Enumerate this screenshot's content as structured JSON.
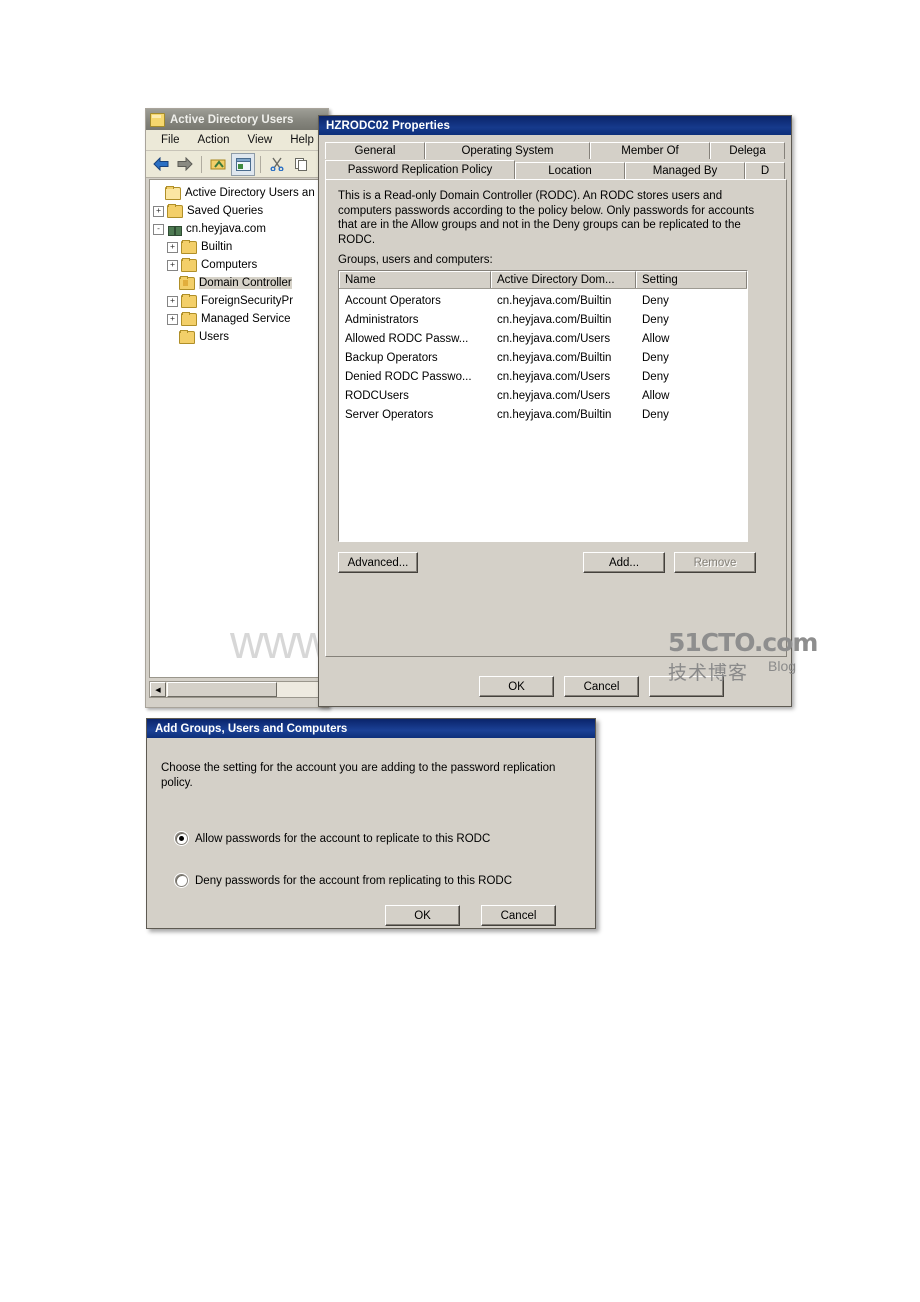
{
  "mmc_window": {
    "title": "Active Directory Users",
    "icon": "console-folder-icon",
    "menu": [
      "File",
      "Action",
      "View",
      "Help"
    ],
    "toolbar_icons": [
      "back-arrow-icon",
      "forward-arrow-icon",
      "up-folder-icon",
      "properties-icon",
      "cut-scissors-icon",
      "copy-icon"
    ],
    "tree": [
      {
        "label": "Active Directory Users an",
        "indent": 0,
        "expander": "",
        "icon": "console-root-icon",
        "selected": false
      },
      {
        "label": "Saved Queries",
        "indent": 1,
        "expander": "+",
        "icon": "folder-icon",
        "selected": false
      },
      {
        "label": "cn.heyjava.com",
        "indent": 1,
        "expander": "-",
        "icon": "domain-icon",
        "selected": false
      },
      {
        "label": "Builtin",
        "indent": 2,
        "expander": "+",
        "icon": "folder-icon",
        "selected": false
      },
      {
        "label": "Computers",
        "indent": 2,
        "expander": "+",
        "icon": "folder-icon",
        "selected": false
      },
      {
        "label": "Domain Controller",
        "indent": 2,
        "expander": "",
        "icon": "ou-folder-icon",
        "selected": true
      },
      {
        "label": "ForeignSecurityPr",
        "indent": 2,
        "expander": "+",
        "icon": "folder-icon",
        "selected": false
      },
      {
        "label": "Managed Service",
        "indent": 2,
        "expander": "+",
        "icon": "folder-icon",
        "selected": false
      },
      {
        "label": "Users",
        "indent": 2,
        "expander": "",
        "icon": "folder-icon",
        "selected": false
      }
    ]
  },
  "properties_dialog": {
    "title": "HZRODC02 Properties",
    "tabs_row1": [
      {
        "label": "General",
        "active": false,
        "width": 100
      },
      {
        "label": "Operating System",
        "active": false,
        "width": 165
      },
      {
        "label": "Member Of",
        "active": false,
        "width": 120
      },
      {
        "label": "Delega",
        "active": false,
        "width": 75
      }
    ],
    "tabs_row2": [
      {
        "label": "Password Replication Policy",
        "active": true,
        "width": 190
      },
      {
        "label": "Location",
        "active": false,
        "width": 110
      },
      {
        "label": "Managed By",
        "active": false,
        "width": 120
      },
      {
        "label": "D",
        "active": false,
        "width": 40
      }
    ],
    "description": "This is a Read-only Domain Controller (RODC).  An RODC stores users and computers passwords according to the policy below.  Only passwords for accounts that are in the Allow groups and not in the Deny groups can be replicated to the RODC.",
    "list_label": "Groups, users and computers:",
    "columns": [
      {
        "label": "Name",
        "width": 152
      },
      {
        "label": "Active Directory Dom...",
        "width": 145
      },
      {
        "label": "Setting",
        "width": 111
      }
    ],
    "rows": [
      {
        "name": "Account Operators",
        "domain": "cn.heyjava.com/Builtin",
        "setting": "Deny"
      },
      {
        "name": "Administrators",
        "domain": "cn.heyjava.com/Builtin",
        "setting": "Deny"
      },
      {
        "name": "Allowed RODC Passw...",
        "domain": "cn.heyjava.com/Users",
        "setting": "Allow"
      },
      {
        "name": "Backup Operators",
        "domain": "cn.heyjava.com/Builtin",
        "setting": "Deny"
      },
      {
        "name": "Denied RODC Passwo...",
        "domain": "cn.heyjava.com/Users",
        "setting": "Deny"
      },
      {
        "name": "RODCUsers",
        "domain": "cn.heyjava.com/Users",
        "setting": "Allow"
      },
      {
        "name": "Server Operators",
        "domain": "cn.heyjava.com/Builtin",
        "setting": "Deny"
      }
    ],
    "buttons": {
      "advanced": "Advanced...",
      "add": "Add...",
      "remove": "Remove",
      "ok": "OK",
      "cancel": "Cancel",
      "apply": ""
    }
  },
  "add_dialog": {
    "title": "Add Groups, Users and Computers",
    "instruction": "Choose the setting for the account you are adding to the password replication policy.",
    "options": [
      {
        "label": "Allow passwords for the account to replicate to this RODC",
        "selected": true
      },
      {
        "label": "Deny passwords for the account from replicating to this RODC",
        "selected": false
      }
    ],
    "buttons": {
      "ok": "OK",
      "cancel": "Cancel"
    }
  },
  "watermarks": {
    "bdocx": "www.bdocx.com",
    "cto_line1": "51CTO.com",
    "cto_line2": "技术博客",
    "cto_line3": "Blog"
  },
  "colors": {
    "active_title": "#0a246a",
    "inactive_title": "#87877f",
    "face": "#d4d0c8",
    "folder": "#f3cf69"
  }
}
